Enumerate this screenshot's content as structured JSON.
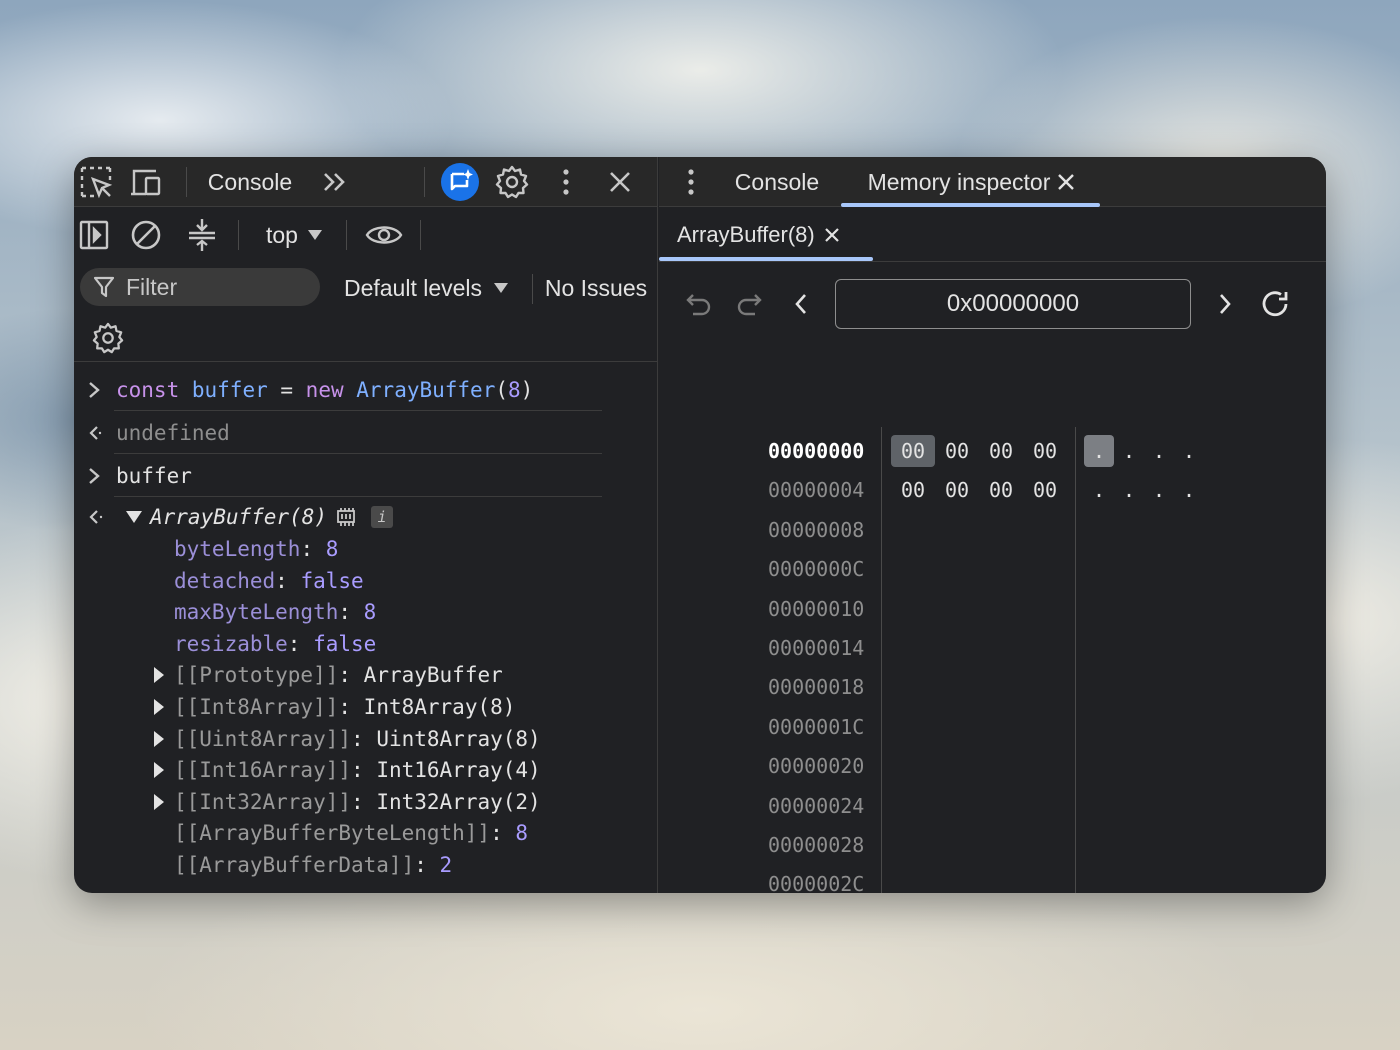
{
  "left_toolbar": {
    "console_tab": "Console",
    "icons": [
      "inspect-element-icon",
      "device-toggle-icon",
      "more-tabs-icon",
      "ai-assistance-icon",
      "settings-icon",
      "more-options-icon",
      "close-icon"
    ]
  },
  "console_toolbar": {
    "context": "top",
    "filter_placeholder": "Filter",
    "levels": "Default levels",
    "issues": "No Issues"
  },
  "console": {
    "input1": {
      "kw_const": "const",
      "var": "buffer",
      "eq": " = ",
      "kw_new": "new",
      "cls": "ArrayBuffer",
      "paren_open": "(",
      "arg": "8",
      "paren_close": ")"
    },
    "output1": "undefined",
    "input2": "buffer",
    "object_header": "ArrayBuffer(8)",
    "info_badge": "i",
    "props": [
      {
        "key": "byteLength",
        "value": "8"
      },
      {
        "key": "detached",
        "value": "false"
      },
      {
        "key": "maxByteLength",
        "value": "8"
      },
      {
        "key": "resizable",
        "value": "false"
      }
    ],
    "internals": [
      {
        "key": "[[Prototype]]",
        "value": "ArrayBuffer",
        "expandable": true
      },
      {
        "key": "[[Int8Array]]",
        "value": "Int8Array(8)",
        "expandable": true
      },
      {
        "key": "[[Uint8Array]]",
        "value": "Uint8Array(8)",
        "expandable": true
      },
      {
        "key": "[[Int16Array]]",
        "value": "Int16Array(4)",
        "expandable": true
      },
      {
        "key": "[[Int32Array]]",
        "value": "Int32Array(2)",
        "expandable": true
      },
      {
        "key": "[[ArrayBufferByteLength]]",
        "value": "8",
        "expandable": false
      },
      {
        "key": "[[ArrayBufferData]]",
        "value": "2",
        "expandable": false
      }
    ]
  },
  "right_toolbar": {
    "console_tab": "Console",
    "memory_tab": "Memory inspector"
  },
  "memory": {
    "buffer_tab": "ArrayBuffer(8)",
    "address": "0x00000000",
    "rows": [
      {
        "addr": "00000000",
        "bytes": [
          "00",
          "00",
          "00",
          "00"
        ],
        "ascii": [
          ".",
          ".",
          ".",
          "."
        ]
      },
      {
        "addr": "00000004",
        "bytes": [
          "00",
          "00",
          "00",
          "00"
        ],
        "ascii": [
          ".",
          ".",
          ".",
          "."
        ]
      },
      {
        "addr": "00000008",
        "bytes": [],
        "ascii": []
      },
      {
        "addr": "0000000C",
        "bytes": [],
        "ascii": []
      },
      {
        "addr": "00000010",
        "bytes": [],
        "ascii": []
      },
      {
        "addr": "00000014",
        "bytes": [],
        "ascii": []
      },
      {
        "addr": "00000018",
        "bytes": [],
        "ascii": []
      },
      {
        "addr": "0000001C",
        "bytes": [],
        "ascii": []
      },
      {
        "addr": "00000020",
        "bytes": [],
        "ascii": []
      },
      {
        "addr": "00000024",
        "bytes": [],
        "ascii": []
      },
      {
        "addr": "00000028",
        "bytes": [],
        "ascii": []
      },
      {
        "addr": "0000002C",
        "bytes": [],
        "ascii": []
      }
    ]
  }
}
